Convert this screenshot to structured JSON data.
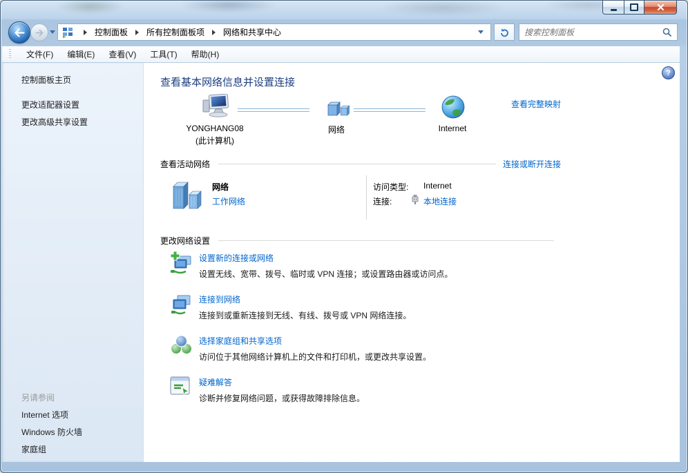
{
  "nav": {
    "breadcrumb": [
      "控制面板",
      "所有控制面板项",
      "网络和共享中心"
    ],
    "search_placeholder": "搜索控制面板"
  },
  "menu": {
    "items": [
      "文件(F)",
      "编辑(E)",
      "查看(V)",
      "工具(T)",
      "帮助(H)"
    ]
  },
  "sidebar": {
    "home": "控制面板主页",
    "links": [
      "更改适配器设置",
      "更改高级共享设置"
    ],
    "see_also": {
      "header": "另请参阅",
      "links": [
        "Internet 选项",
        "Windows 防火墙",
        "家庭组"
      ]
    }
  },
  "main": {
    "title": "查看基本网络信息并设置连接",
    "help_glyph": "?",
    "map": {
      "computer_name": "YONGHANG08",
      "computer_note": "(此计算机)",
      "network_label": "网络",
      "internet_label": "Internet",
      "view_full_map": "查看完整映射"
    },
    "active_networks": {
      "header": "查看活动网络",
      "connect_disconnect": "连接或断开连接",
      "network_name": "网络",
      "network_category": "工作网络",
      "access_type_label": "访问类型:",
      "access_type_value": "Internet",
      "connections_label": "连接:",
      "connections_value": "本地连接"
    },
    "network_settings": {
      "header": "更改网络设置",
      "tasks": [
        {
          "title": "设置新的连接或网络",
          "desc": "设置无线、宽带、拨号、临时或 VPN 连接；或设置路由器或访问点。"
        },
        {
          "title": "连接到网络",
          "desc": "连接到或重新连接到无线、有线、拨号或 VPN 网络连接。"
        },
        {
          "title": "选择家庭组和共享选项",
          "desc": "访问位于其他网络计算机上的文件和打印机，或更改共享设置。"
        },
        {
          "title": "疑难解答",
          "desc": "诊断并修复网络问题，或获得故障排除信息。"
        }
      ]
    }
  },
  "colors": {
    "link": "#0066cc",
    "heading": "#1d3e81",
    "close_button": "#c94a2a",
    "sidebar_bg": "#e3edf8"
  }
}
